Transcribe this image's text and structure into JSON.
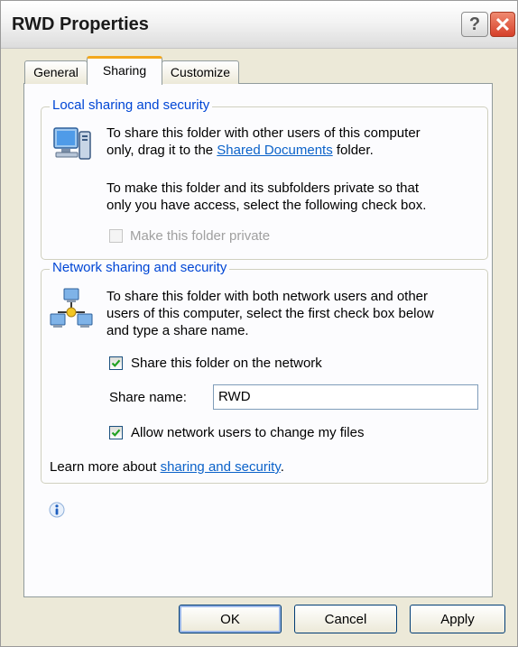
{
  "window": {
    "title": "RWD Properties",
    "help_label": "?",
    "close_label": "✕"
  },
  "tabs": [
    {
      "label": "General"
    },
    {
      "label": "Sharing",
      "selected": true
    },
    {
      "label": "Customize"
    }
  ],
  "local": {
    "legend": "Local sharing and security",
    "line1": "To share this folder with other users of this computer",
    "line2_prefix": "only, drag it to the ",
    "line2_link": "Shared Documents",
    "line2_suffix": " folder.",
    "line3": "To make this folder and its subfolders private so that",
    "line4": "only you have access, select the following check box.",
    "private_label": "Make this folder private",
    "private_checked": false,
    "private_enabled": false,
    "icon": "computer-share-icon"
  },
  "network": {
    "legend": "Network sharing and security",
    "line1": "To share this folder with both network users and other",
    "line2": "users of this computer, select the first check box below",
    "line3": "and type a share name.",
    "share_label": "Share this folder on the network",
    "share_checked": true,
    "share_name_label": "Share name:",
    "share_name_value": "RWD",
    "allow_label": "Allow network users to change my files",
    "allow_checked": true,
    "learn_prefix": "Learn more about ",
    "learn_link": "sharing and security",
    "learn_suffix": ".",
    "icon": "network-share-icon"
  },
  "info_icon": "info-icon",
  "buttons": {
    "ok": "OK",
    "cancel": "Cancel",
    "apply": "Apply"
  },
  "colors": {
    "accent_link": "#0b62c9",
    "legend": "#0046d5",
    "tab_highlight": "#f3a81c"
  }
}
